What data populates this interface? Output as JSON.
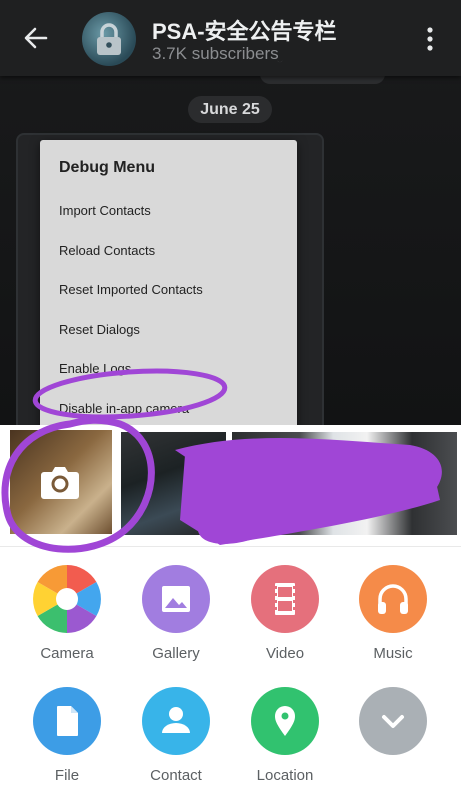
{
  "header": {
    "channel_title": "PSA-安全公告专栏",
    "subscribers": "3.7K subscribers"
  },
  "chat": {
    "date_chip": "June 25"
  },
  "debug_menu": {
    "title": "Debug Menu",
    "items": [
      "Import Contacts",
      "Reload Contacts",
      "Reset Imported Contacts",
      "Reset Dialogs",
      "Enable Logs",
      "Disable in-app camera"
    ]
  },
  "attach_sheet": {
    "options_row1": [
      {
        "label": "Camera",
        "icon": "aperture-icon"
      },
      {
        "label": "Gallery",
        "icon": "image-icon",
        "color": "#a17de0"
      },
      {
        "label": "Video",
        "icon": "film-icon",
        "color": "#e5707c"
      },
      {
        "label": "Music",
        "icon": "headphones-icon",
        "color": "#f58b49"
      }
    ],
    "options_row2": [
      {
        "label": "File",
        "icon": "file-icon",
        "color": "#3d9de6"
      },
      {
        "label": "Contact",
        "icon": "person-icon",
        "color": "#38b4e9"
      },
      {
        "label": "Location",
        "icon": "pin-icon",
        "color": "#31c26f"
      },
      {
        "label": "",
        "icon": "chevron-down-icon",
        "color": "#aab0b5"
      }
    ]
  },
  "colors": {
    "annotation_purple": "#a046d6",
    "header_bg": "#1f2021",
    "menu_bg": "#d9d9d9"
  }
}
